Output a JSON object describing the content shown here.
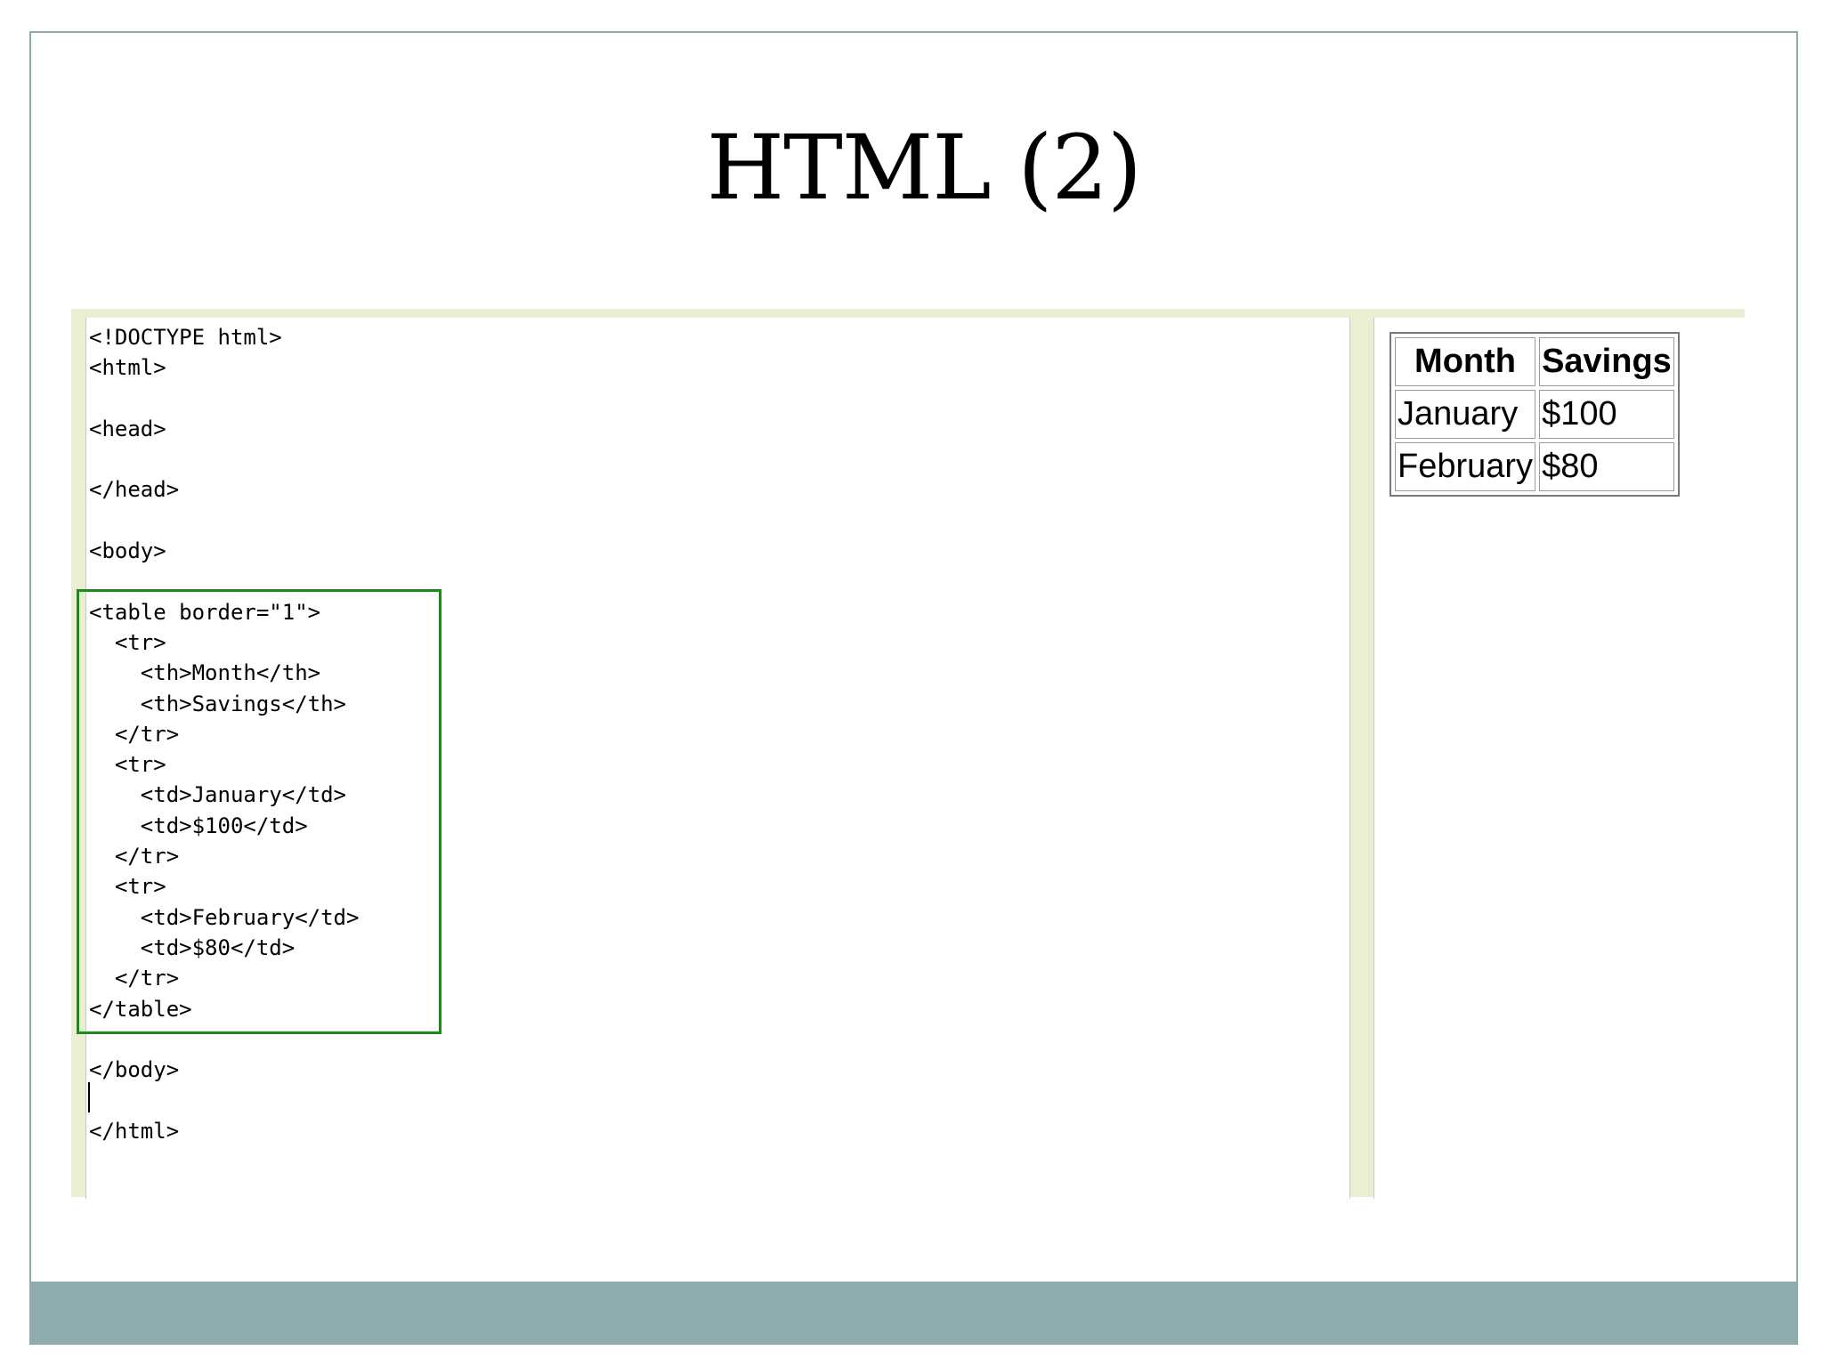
{
  "slide": {
    "title": "HTML (2)"
  },
  "editor": {
    "code_lines": [
      "<!DOCTYPE html>",
      "<html>",
      "",
      "<head>",
      "",
      "</head>",
      "",
      "<body>",
      "",
      "<table border=\"1\">",
      "  <tr>",
      "    <th>Month</th>",
      "    <th>Savings</th>",
      "  </tr>",
      "  <tr>",
      "    <td>January</td>",
      "    <td>$100</td>",
      "  </tr>",
      "  <tr>",
      "    <td>February</td>",
      "    <td>$80</td>",
      "  </tr>",
      "</table>",
      "",
      "</body>",
      "",
      "</html>"
    ],
    "highlight_color": "#1a8a1a"
  },
  "preview": {
    "table": {
      "headers": [
        "Month",
        "Savings"
      ],
      "rows": [
        [
          "January",
          "$100"
        ],
        [
          "February",
          "$80"
        ]
      ]
    }
  },
  "colors": {
    "footer_band": "#8eabae",
    "pane_background": "#eaeed2"
  }
}
